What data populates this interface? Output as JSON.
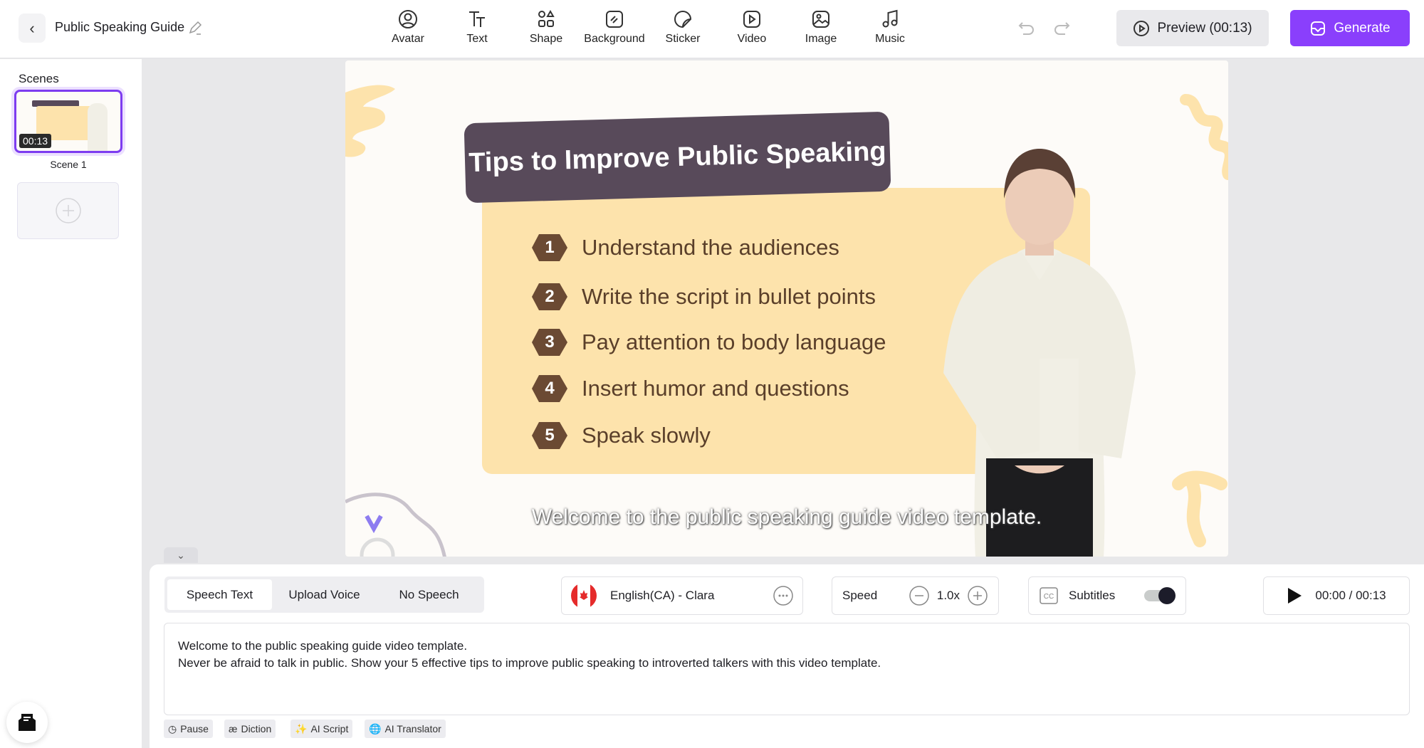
{
  "header": {
    "back_icon": "chevron-left-icon",
    "project_title": "Public Speaking Guide",
    "edit_icon": "pencil-icon",
    "tools": [
      {
        "label": "Avatar",
        "icon": "avatar-icon"
      },
      {
        "label": "Text",
        "icon": "text-icon"
      },
      {
        "label": "Shape",
        "icon": "shape-icon"
      },
      {
        "label": "Background",
        "icon": "background-icon"
      },
      {
        "label": "Sticker",
        "icon": "sticker-icon"
      },
      {
        "label": "Video",
        "icon": "video-icon"
      },
      {
        "label": "Image",
        "icon": "image-icon"
      },
      {
        "label": "Music",
        "icon": "music-icon"
      }
    ],
    "preview_label": "Preview (00:13)",
    "generate_label": "Generate",
    "accent_color": "#8a3ffc"
  },
  "sidebar": {
    "title": "Scenes",
    "scenes": [
      {
        "label": "Scene 1",
        "duration": "00:13",
        "selected": true
      }
    ]
  },
  "canvas": {
    "heading": "Tips to Improve Public Speaking",
    "items": [
      {
        "number": "1",
        "text": "Understand the audiences"
      },
      {
        "number": "2",
        "text": "Write the script in bullet points"
      },
      {
        "number": "3",
        "text": "Pay attention to body language"
      },
      {
        "number": "4",
        "text": "Insert humor and questions"
      },
      {
        "number": "5",
        "text": "Speak slowly"
      }
    ],
    "subtitle": "Welcome to the public speaking guide video template."
  },
  "panel": {
    "tabs": [
      {
        "label": "Speech Text",
        "active": true
      },
      {
        "label": "Upload Voice",
        "active": false
      },
      {
        "label": "No Speech",
        "active": false
      }
    ],
    "voice": "English(CA) - Clara",
    "speed_label": "Speed",
    "speed_value": "1.0x",
    "subtitles_label": "Subtitles",
    "subtitles_on": true,
    "time": "00:00 / 00:13",
    "script_lines": [
      "Welcome to the public speaking guide video template.",
      "Never be afraid to talk in public. Show your 5 effective tips to improve public speaking to introverted talkers with this video template."
    ],
    "tools": [
      "Pause",
      "Diction",
      "AI Script",
      "AI Translator"
    ]
  }
}
